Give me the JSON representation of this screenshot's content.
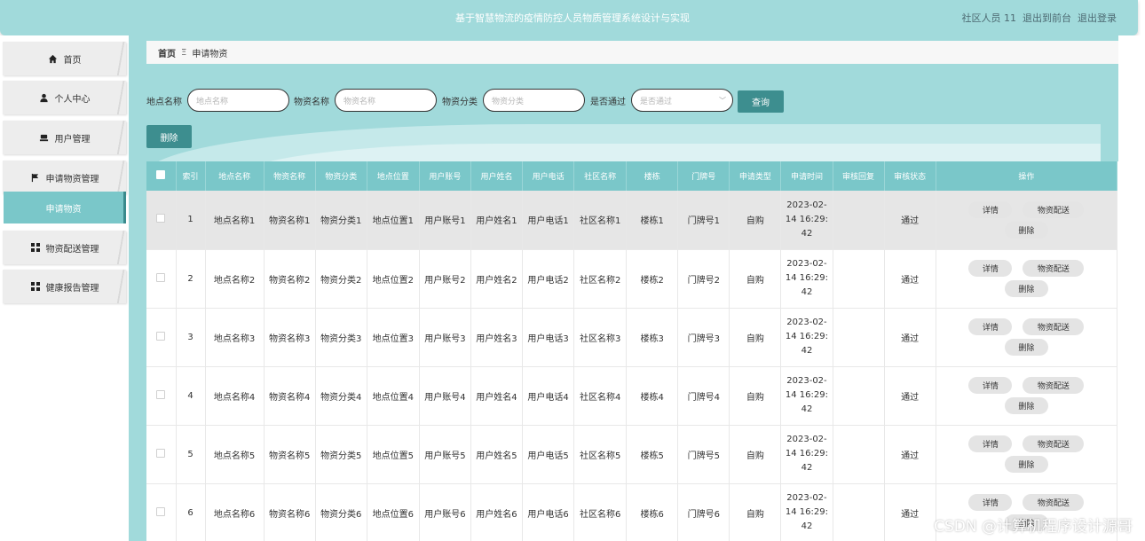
{
  "header": {
    "title": "基于智慧物流的疫情防控人员物质管理系统设计与实现",
    "user": "社区人员 11",
    "back_front": "退出到前台",
    "logout": "退出登录"
  },
  "sidebar": {
    "items": [
      {
        "label": "首页",
        "icon": "home-icon"
      },
      {
        "label": "个人中心",
        "icon": "user-icon"
      },
      {
        "label": "用户管理",
        "icon": "user-manage-icon"
      },
      {
        "label": "申请物资管理",
        "icon": "flag-icon"
      },
      {
        "label": "申请物资",
        "icon": ""
      },
      {
        "label": "物资配送管理",
        "icon": "grid-icon"
      },
      {
        "label": "健康报告管理",
        "icon": "grid-icon"
      }
    ]
  },
  "breadcrumb": {
    "home": "首页",
    "sep": "Ξ",
    "current": "申请物资"
  },
  "search": {
    "f1_label": "地点名称",
    "f1_ph": "地点名称",
    "f2_label": "物资名称",
    "f2_ph": "物资名称",
    "f3_label": "物资分类",
    "f3_ph": "物资分类",
    "f4_label": "是否通过",
    "f4_ph": "是否通过",
    "query": "查询",
    "delete": "删除"
  },
  "table": {
    "headers": [
      "索引",
      "地点名称",
      "物资名称",
      "物资分类",
      "地点位置",
      "用户账号",
      "用户姓名",
      "用户电话",
      "社区名称",
      "楼栋",
      "门牌号",
      "申请类型",
      "申请时间",
      "审核回复",
      "审核状态",
      "操作"
    ],
    "ops": {
      "detail": "详情",
      "deliver": "物资配送",
      "delete": "删除"
    },
    "rows": [
      {
        "idx": "1",
        "c1": "地点名称1",
        "c2": "物资名称1",
        "c3": "物资分类1",
        "c4": "地点位置1",
        "c5": "用户账号1",
        "c6": "用户姓名1",
        "c7": "用户电话1",
        "c8": "社区名称1",
        "c9": "楼栋1",
        "c10": "门牌号1",
        "c11": "自购",
        "t1": "2023-02-",
        "t2": "14 16:29:",
        "t3": "42",
        "reply": "",
        "status": "通过"
      },
      {
        "idx": "2",
        "c1": "地点名称2",
        "c2": "物资名称2",
        "c3": "物资分类2",
        "c4": "地点位置2",
        "c5": "用户账号2",
        "c6": "用户姓名2",
        "c7": "用户电话2",
        "c8": "社区名称2",
        "c9": "楼栋2",
        "c10": "门牌号2",
        "c11": "自购",
        "t1": "2023-02-",
        "t2": "14 16:29:",
        "t3": "42",
        "reply": "",
        "status": "通过"
      },
      {
        "idx": "3",
        "c1": "地点名称3",
        "c2": "物资名称3",
        "c3": "物资分类3",
        "c4": "地点位置3",
        "c5": "用户账号3",
        "c6": "用户姓名3",
        "c7": "用户电话3",
        "c8": "社区名称3",
        "c9": "楼栋3",
        "c10": "门牌号3",
        "c11": "自购",
        "t1": "2023-02-",
        "t2": "14 16:29:",
        "t3": "42",
        "reply": "",
        "status": "通过"
      },
      {
        "idx": "4",
        "c1": "地点名称4",
        "c2": "物资名称4",
        "c3": "物资分类4",
        "c4": "地点位置4",
        "c5": "用户账号4",
        "c6": "用户姓名4",
        "c7": "用户电话4",
        "c8": "社区名称4",
        "c9": "楼栋4",
        "c10": "门牌号4",
        "c11": "自购",
        "t1": "2023-02-",
        "t2": "14 16:29:",
        "t3": "42",
        "reply": "",
        "status": "通过"
      },
      {
        "idx": "5",
        "c1": "地点名称5",
        "c2": "物资名称5",
        "c3": "物资分类5",
        "c4": "地点位置5",
        "c5": "用户账号5",
        "c6": "用户姓名5",
        "c7": "用户电话5",
        "c8": "社区名称5",
        "c9": "楼栋5",
        "c10": "门牌号5",
        "c11": "自购",
        "t1": "2023-02-",
        "t2": "14 16:29:",
        "t3": "42",
        "reply": "",
        "status": "通过"
      },
      {
        "idx": "6",
        "c1": "地点名称6",
        "c2": "物资名称6",
        "c3": "物资分类6",
        "c4": "地点位置6",
        "c5": "用户账号6",
        "c6": "用户姓名6",
        "c7": "用户电话6",
        "c8": "社区名称6",
        "c9": "楼栋6",
        "c10": "门牌号6",
        "c11": "自购",
        "t1": "2023-02-",
        "t2": "14 16:29:",
        "t3": "42",
        "reply": "",
        "status": "通过"
      }
    ]
  },
  "watermark": "CSDN @计算机程序设计源哥"
}
